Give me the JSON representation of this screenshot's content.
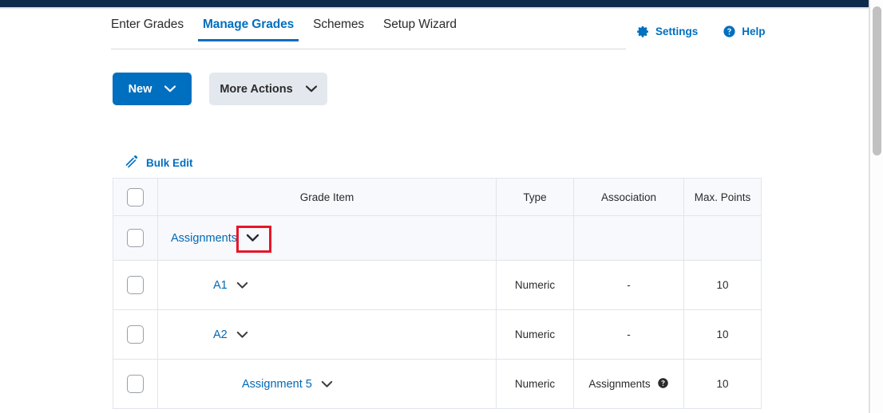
{
  "colors": {
    "topbar": "#0c2b4c",
    "accent": "#006fbf",
    "link": "#0069b4",
    "annotation": "#e8152a",
    "secondary_button": "#e3e8ef",
    "row_alt": "#f7f9fc"
  },
  "tabs": [
    {
      "label": "Enter Grades",
      "active": false
    },
    {
      "label": "Manage Grades",
      "active": true
    },
    {
      "label": "Schemes",
      "active": false
    },
    {
      "label": "Setup Wizard",
      "active": false
    }
  ],
  "util_links": [
    {
      "label": "Settings",
      "icon": "gear-icon"
    },
    {
      "label": "Help",
      "icon": "question-circle-icon"
    }
  ],
  "toolbar": {
    "new_label": "New",
    "more_actions_label": "More Actions",
    "bulk_edit_label": "Bulk Edit",
    "bulk_edit_icon": "pencil-edit-icon"
  },
  "table": {
    "headers": {
      "select": "",
      "grade_item": "Grade Item",
      "type": "Type",
      "association": "Association",
      "max_points": "Max. Points"
    },
    "rows": [
      {
        "name": "Assignments",
        "kind": "category",
        "type": "",
        "association": "",
        "association_icon": "",
        "max_points": "",
        "highlighted_caret": true
      },
      {
        "name": "A1",
        "kind": "item",
        "type": "Numeric",
        "association": "-",
        "association_icon": "",
        "max_points": "10",
        "highlighted_caret": false
      },
      {
        "name": "A2",
        "kind": "item",
        "type": "Numeric",
        "association": "-",
        "association_icon": "",
        "max_points": "10",
        "highlighted_caret": false
      },
      {
        "name": "Assignment 5",
        "kind": "item",
        "type": "Numeric",
        "association": "Assignments",
        "association_icon": "question-circle-filled-icon",
        "max_points": "10",
        "highlighted_caret": false
      }
    ]
  },
  "scrollbar": {
    "position": "top"
  }
}
